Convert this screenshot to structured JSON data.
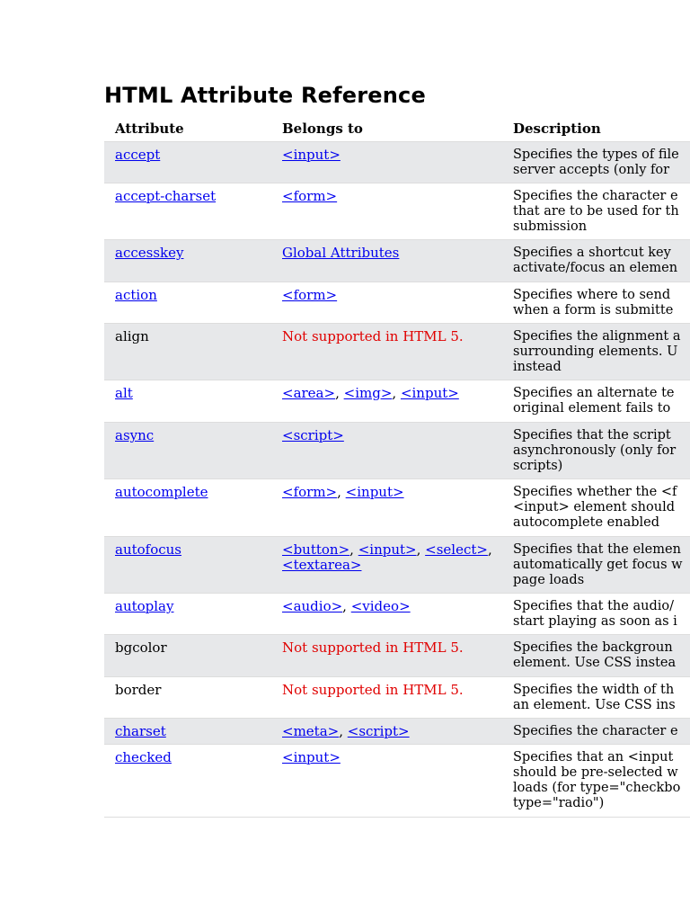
{
  "title": "HTML Attribute Reference",
  "colors": {
    "link": "#0000ee",
    "unsupported": "#e00000",
    "stripe": "#e7e8ea"
  },
  "headers": [
    "Attribute",
    "Belongs to",
    "Description"
  ],
  "rows": [
    {
      "attr": "accept",
      "attr_link": true,
      "belongs": [
        {
          "text": "<input>",
          "type": "link"
        }
      ],
      "desc": "Specifies the types of file\nserver accepts (only for"
    },
    {
      "attr": "accept-charset",
      "attr_link": true,
      "belongs": [
        {
          "text": "<form>",
          "type": "link"
        }
      ],
      "desc": "Specifies the character e\nthat are to be used for th\nsubmission"
    },
    {
      "attr": "accesskey",
      "attr_link": true,
      "belongs": [
        {
          "text": "Global Attributes",
          "type": "link"
        }
      ],
      "desc": "Specifies a shortcut key\nactivate/focus an elemen"
    },
    {
      "attr": "action",
      "attr_link": true,
      "belongs": [
        {
          "text": "<form>",
          "type": "link"
        }
      ],
      "desc": "Specifies where to send\nwhen a form is submitte"
    },
    {
      "attr": "align",
      "attr_link": false,
      "belongs": [
        {
          "text": "Not supported in HTML 5.",
          "type": "red"
        }
      ],
      "desc": "Specifies the alignment a\nsurrounding elements. U\ninstead"
    },
    {
      "attr": "alt",
      "attr_link": true,
      "belongs": [
        {
          "text": "<area>",
          "type": "link"
        },
        {
          "text": "<img>",
          "type": "link"
        },
        {
          "text": "<input>",
          "type": "link"
        }
      ],
      "desc": "Specifies an alternate te\noriginal element fails to"
    },
    {
      "attr": "async",
      "attr_link": true,
      "belongs": [
        {
          "text": "<script>",
          "type": "link"
        }
      ],
      "desc": "Specifies that the script\nasynchronously (only for\nscripts)"
    },
    {
      "attr": "autocomplete",
      "attr_link": true,
      "belongs": [
        {
          "text": "<form>",
          "type": "link"
        },
        {
          "text": "<input>",
          "type": "link"
        }
      ],
      "desc": "Specifies whether the <f\n<input> element should\nautocomplete enabled"
    },
    {
      "attr": "autofocus",
      "attr_link": true,
      "belongs": [
        {
          "text": "<button>",
          "type": "link"
        },
        {
          "text": "<input>",
          "type": "link"
        },
        {
          "text": "<select>",
          "type": "link"
        },
        {
          "text": "<textarea>",
          "type": "link",
          "newline": true
        }
      ],
      "desc": "Specifies that the elemen\nautomatically get focus w\npage loads"
    },
    {
      "attr": "autoplay",
      "attr_link": true,
      "belongs": [
        {
          "text": "<audio>",
          "type": "link"
        },
        {
          "text": "<video>",
          "type": "link"
        }
      ],
      "desc": "Specifies that the audio/\nstart playing as soon as i"
    },
    {
      "attr": "bgcolor",
      "attr_link": false,
      "belongs": [
        {
          "text": "Not supported in HTML 5.",
          "type": "red"
        }
      ],
      "desc": "Specifies the backgroun\nelement. Use CSS instea"
    },
    {
      "attr": "border",
      "attr_link": false,
      "belongs": [
        {
          "text": "Not supported in HTML 5.",
          "type": "red"
        }
      ],
      "desc": "Specifies the width of th\nan element. Use CSS ins"
    },
    {
      "attr": "charset",
      "attr_link": true,
      "belongs": [
        {
          "text": "<meta>",
          "type": "link"
        },
        {
          "text": "<script>",
          "type": "link"
        }
      ],
      "desc": "Specifies the character e"
    },
    {
      "attr": "checked",
      "attr_link": true,
      "belongs": [
        {
          "text": "<input>",
          "type": "link"
        }
      ],
      "desc": "Specifies that an <input\nshould be pre-selected w\nloads (for type=\"checkbo\ntype=\"radio\")"
    }
  ]
}
